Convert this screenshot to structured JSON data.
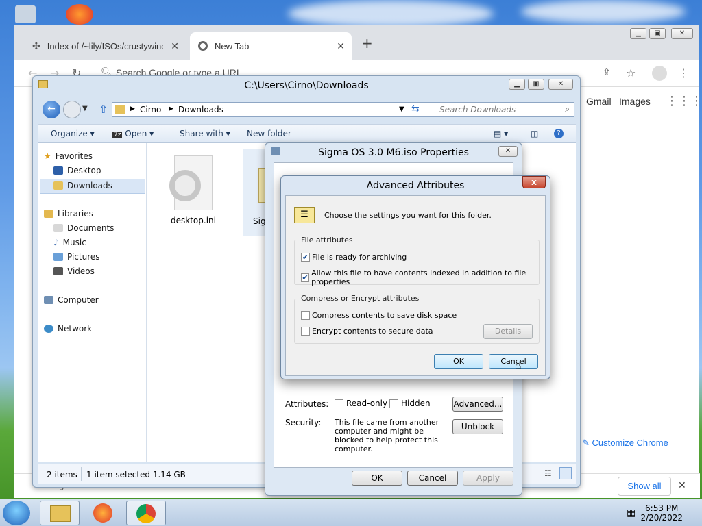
{
  "chrome": {
    "tabs": [
      {
        "label": "Index of /~lily/ISOs/crustywindo",
        "active": false
      },
      {
        "label": "New Tab",
        "active": true
      }
    ],
    "omnibox_placeholder": "Search Google or type a URL",
    "ntp_links": [
      "Gmail",
      "Images"
    ],
    "customize_label": "Customize Chrome",
    "download_item": "Sigma OS 3.0 M6.iso",
    "show_all_label": "Show all"
  },
  "explorer": {
    "title": "C:\\Users\\Cirno\\Downloads",
    "breadcrumb": [
      "Cirno",
      "Downloads"
    ],
    "search_placeholder": "Search Downloads",
    "commands": [
      "Organize",
      "Open",
      "Share with",
      "New folder"
    ],
    "nav": {
      "favorites": "Favorites",
      "desktop": "Desktop",
      "downloads": "Downloads",
      "libraries": "Libraries",
      "documents": "Documents",
      "music": "Music",
      "pictures": "Pictures",
      "videos": "Videos",
      "computer": "Computer",
      "network": "Network"
    },
    "files": [
      {
        "name": "desktop.ini"
      },
      {
        "name": "Sig"
      }
    ],
    "status": {
      "count": "2 items",
      "selected": "1 item selected  1.14 GB"
    }
  },
  "properties": {
    "title": "Sigma OS 3.0 M6.iso Properties",
    "attributes_label": "Attributes:",
    "readonly_label": "Read-only",
    "hidden_label": "Hidden",
    "advanced_label": "Advanced...",
    "security_label": "Security:",
    "security_text": "This file came from another computer and might be blocked to help protect this computer.",
    "unblock_label": "Unblock",
    "ok_label": "OK",
    "cancel_label": "Cancel",
    "apply_label": "Apply"
  },
  "advanced": {
    "title": "Advanced Attributes",
    "close_label": "x",
    "intro": "Choose the settings you want for this folder.",
    "file_attributes_label": "File attributes",
    "archive_label": "File is ready for archiving",
    "archive_checked": true,
    "index_label": "Allow this file to have contents indexed in addition to file properties",
    "index_checked": true,
    "compress_group_label": "Compress or Encrypt attributes",
    "compress_label": "Compress contents to save disk space",
    "compress_checked": false,
    "encrypt_label": "Encrypt contents to secure data",
    "encrypt_checked": false,
    "details_label": "Details",
    "ok_label": "OK",
    "cancel_label": "Cancel"
  },
  "taskbar": {
    "time": "6:53 PM",
    "date": "2/20/2022"
  }
}
